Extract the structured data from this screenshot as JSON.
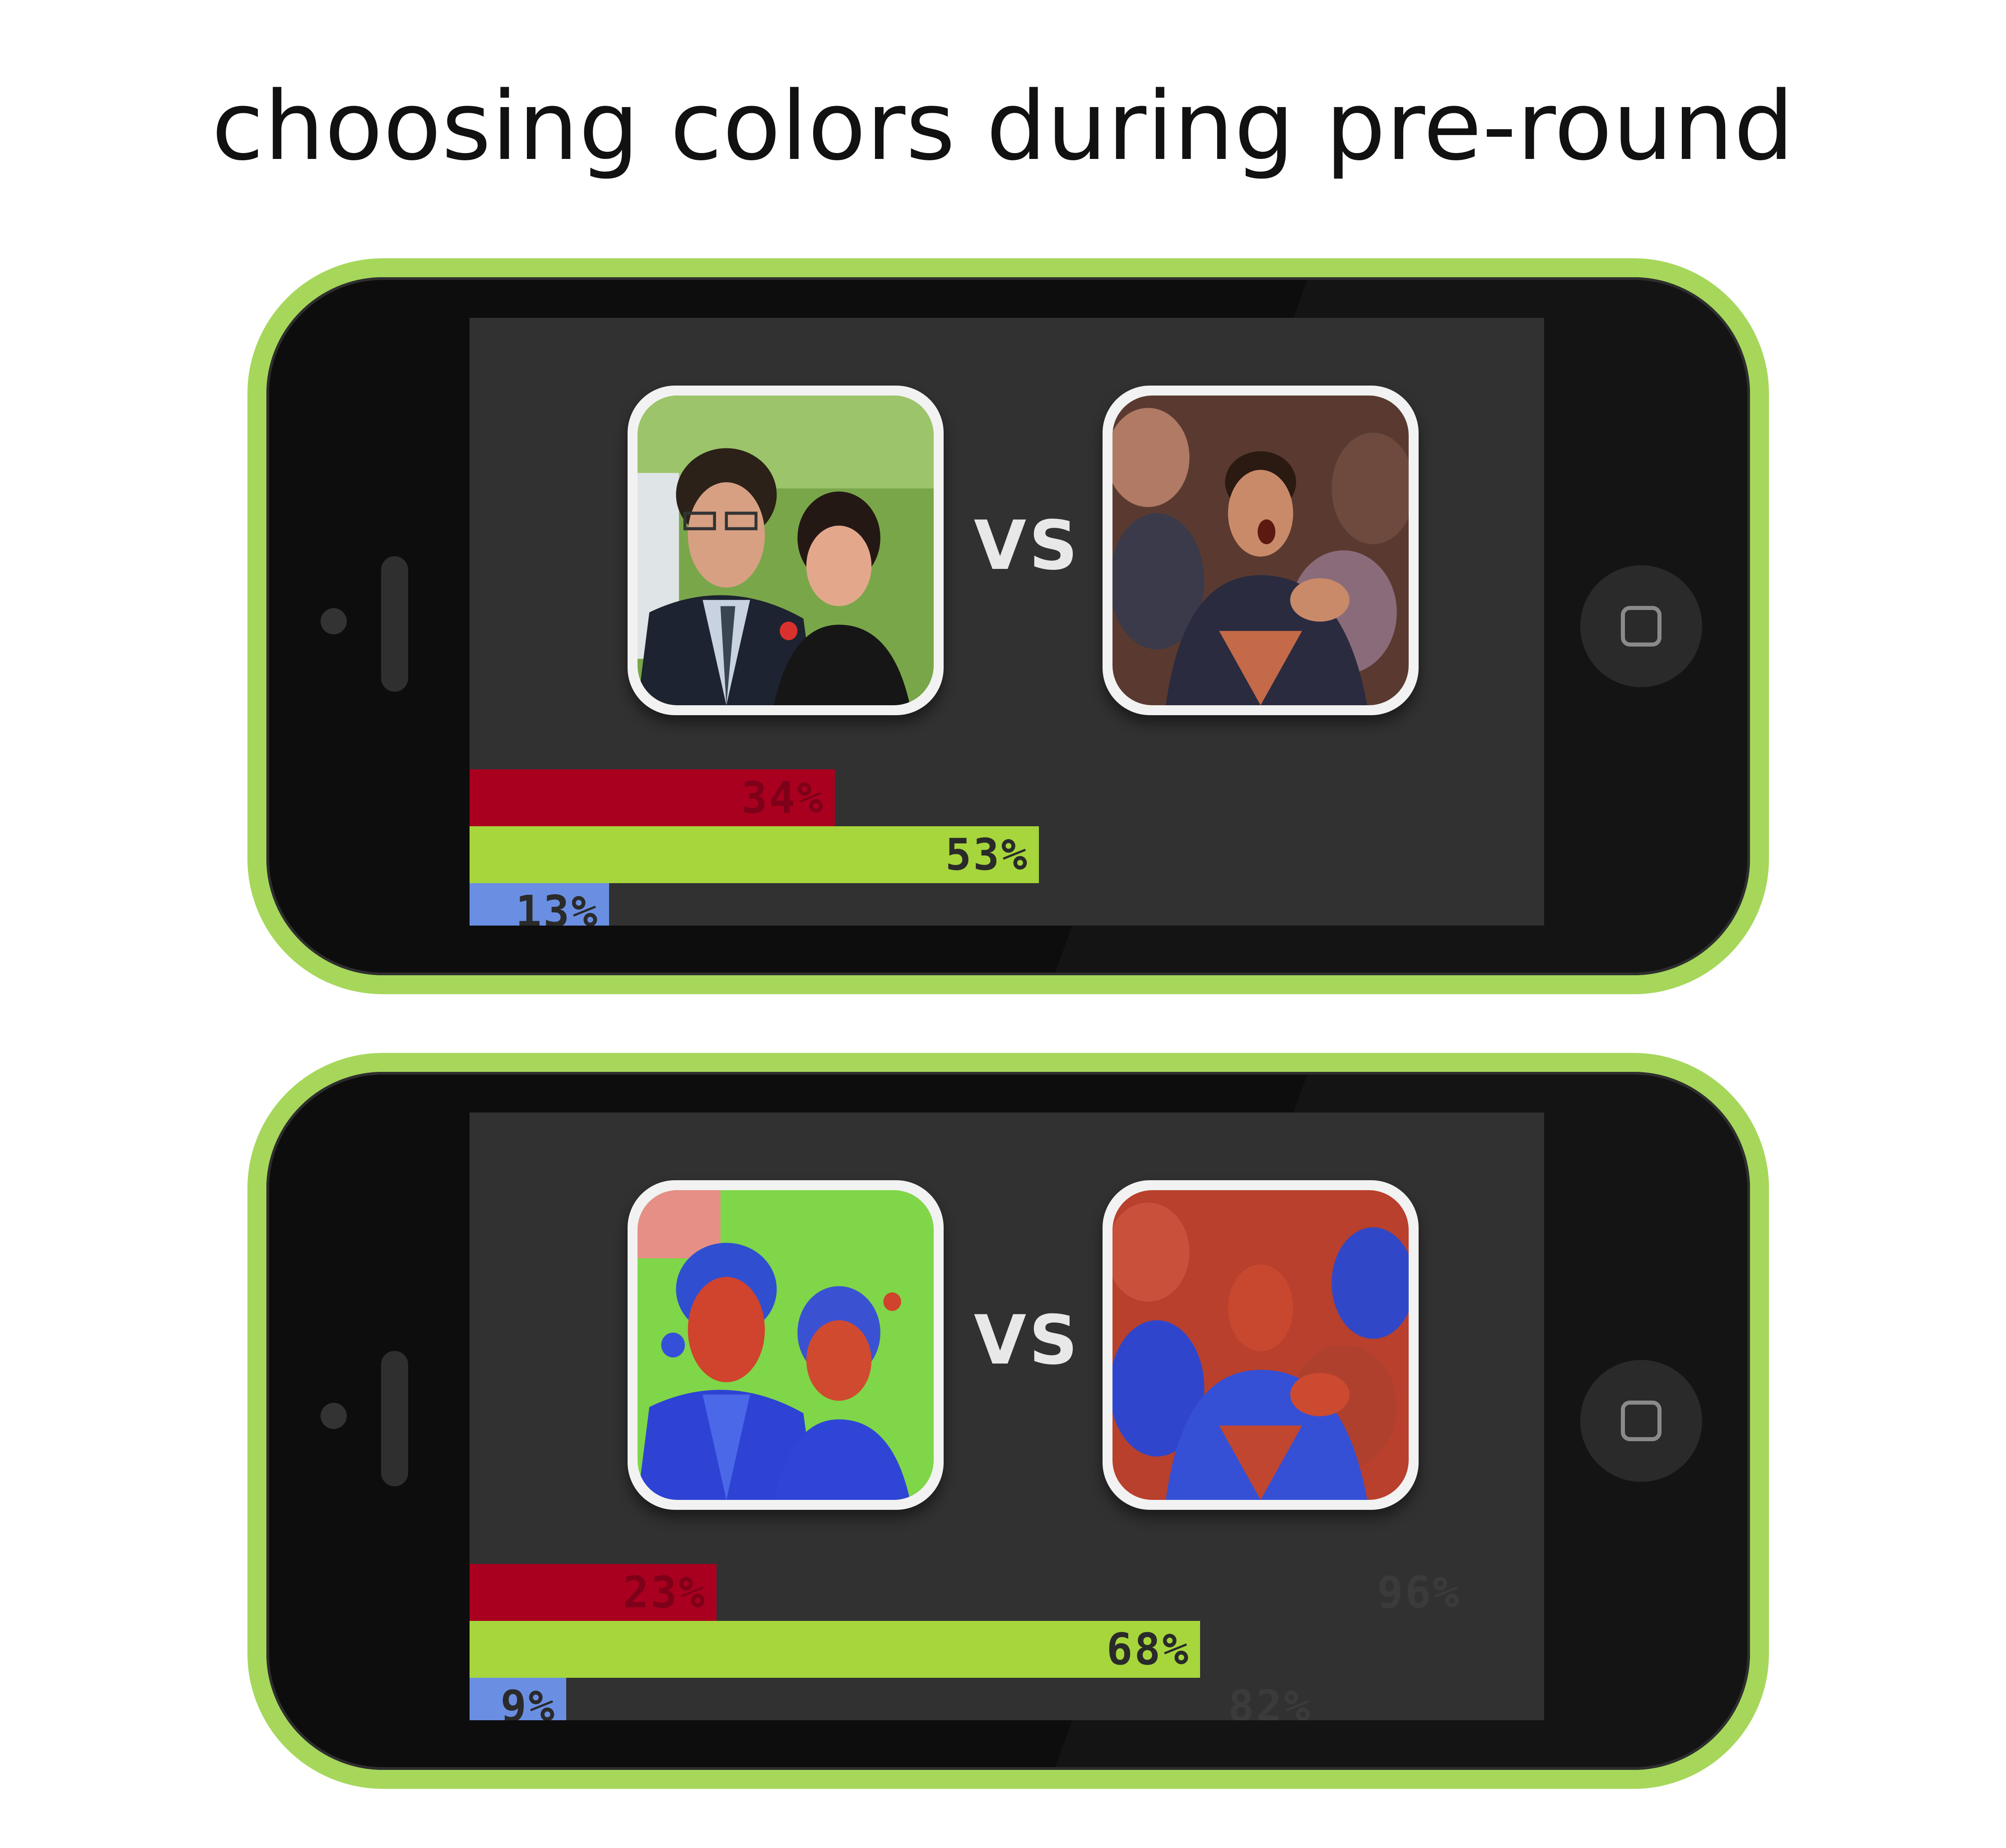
{
  "title": "choosing colors during pre-round",
  "colors": {
    "red": "#aa001f",
    "green": "#a6d63c",
    "blue": "#6a8fe2",
    "phone_frame": "#a6d75b",
    "screen": "#313131"
  },
  "phones": [
    {
      "vs_label": "VS",
      "photo_style": "natural",
      "bars": [
        {
          "color": "red",
          "value": 0.34,
          "label": "34%"
        },
        {
          "color": "green",
          "value": 0.53,
          "label": "53%"
        },
        {
          "color": "blue",
          "value": 0.13,
          "label": "13%"
        }
      ],
      "ghost_labels": []
    },
    {
      "vs_label": "VS",
      "photo_style": "color-segmented",
      "bars": [
        {
          "color": "red",
          "value": 0.23,
          "label": "23%"
        },
        {
          "color": "green",
          "value": 0.68,
          "label": "68%"
        },
        {
          "color": "blue",
          "value": 0.09,
          "label": "9%"
        }
      ],
      "ghost_labels": [
        {
          "row": 0,
          "label": "96%"
        },
        {
          "row": 2,
          "label": "82%"
        }
      ]
    }
  ],
  "icons": {
    "home": "home-button-icon",
    "camera": "front-camera-icon",
    "speaker": "speaker-icon"
  }
}
